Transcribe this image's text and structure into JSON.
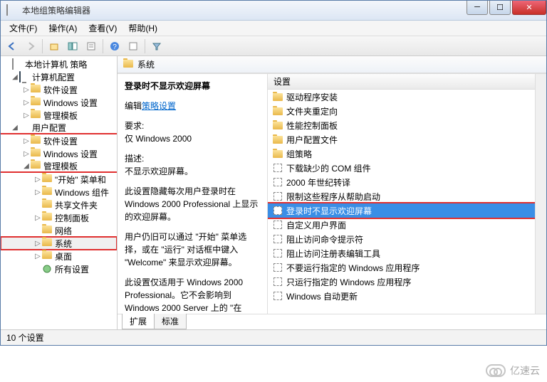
{
  "window": {
    "title": "本地组策略编辑器"
  },
  "menu": {
    "file": "文件(F)",
    "action": "操作(A)",
    "view": "查看(V)",
    "help": "帮助(H)"
  },
  "tree": {
    "root": "本地计算机 策略",
    "computer_config": "计算机配置",
    "software_settings": "软件设置",
    "windows_settings": "Windows 设置",
    "admin_templates": "管理模板",
    "user_config": "用户配置",
    "start_menu": "\"开始\" 菜单和",
    "windows_components": "Windows 组件",
    "shared_folders": "共享文件夹",
    "control_panel": "控制面板",
    "network": "网络",
    "system": "系统",
    "desktop": "桌面",
    "all_settings": "所有设置"
  },
  "header": {
    "label": "系统",
    "column": "设置"
  },
  "detail": {
    "title": "登录时不显示欢迎屏幕",
    "edit_prefix": "编辑",
    "edit_link": "策略设置",
    "req_label": "要求:",
    "req_value": "仅 Windows 2000",
    "desc_label": "描述:",
    "desc1": "不显示欢迎屏幕。",
    "desc2": "此设置隐藏每次用户登录时在 Windows 2000 Professional 上显示的欢迎屏幕。",
    "desc3": "用户仍旧可以通过 \"开始\" 菜单选择，或在 \"运行\" 对话框中键入 \"Welcome\" 来显示欢迎屏幕。",
    "desc4": "此设置仅适用于 Windows 2000 Professional。它不会影响到 Windows 2000 Server 上的 \"在"
  },
  "list": [
    {
      "type": "folder",
      "label": "驱动程序安装"
    },
    {
      "type": "folder",
      "label": "文件夹重定向"
    },
    {
      "type": "folder",
      "label": "性能控制面板"
    },
    {
      "type": "folder",
      "label": "用户配置文件"
    },
    {
      "type": "folder",
      "label": "组策略"
    },
    {
      "type": "setting",
      "label": "下载缺少的 COM 组件"
    },
    {
      "type": "setting",
      "label": "2000 年世纪转译"
    },
    {
      "type": "setting",
      "label": "限制这些程序从帮助启动"
    },
    {
      "type": "setting",
      "label": "登录时不显示欢迎屏幕",
      "selected": true
    },
    {
      "type": "setting",
      "label": "自定义用户界面"
    },
    {
      "type": "setting",
      "label": "阻止访问命令提示符"
    },
    {
      "type": "setting",
      "label": "阻止访问注册表编辑工具"
    },
    {
      "type": "setting",
      "label": "不要运行指定的 Windows 应用程序"
    },
    {
      "type": "setting",
      "label": "只运行指定的 Windows 应用程序"
    },
    {
      "type": "setting",
      "label": "Windows 自动更新"
    }
  ],
  "tabs": {
    "extended": "扩展",
    "standard": "标准"
  },
  "status": "10 个设置",
  "watermark": "亿速云"
}
